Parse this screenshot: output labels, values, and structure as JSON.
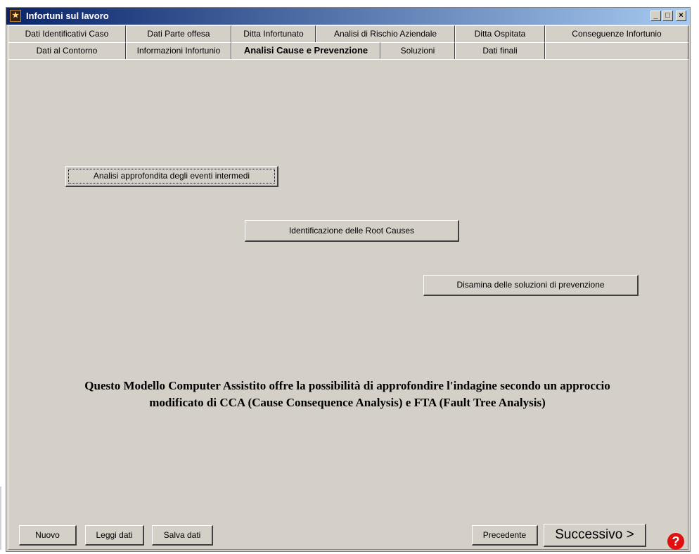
{
  "window": {
    "title": "Infortuni sul lavoro",
    "app_icon": "app-icon",
    "controls": {
      "minimize": "_",
      "maximize": "□",
      "close": "×"
    }
  },
  "tabs": {
    "row1": [
      "Dati Identificativi Caso",
      "Dati Parte offesa",
      "Ditta Infortunato",
      "Analisi di Rischio Aziendale",
      "Ditta Ospitata",
      "Conseguenze Infortunio"
    ],
    "row2": [
      "Dati al Contorno",
      "Informazioni Infortunio",
      "Analisi Cause e Prevenzione",
      "Soluzioni",
      "Dati finali"
    ],
    "active": "Analisi Cause e Prevenzione"
  },
  "main": {
    "buttons": {
      "analisi": "Analisi approfondita degli eventi intermedi",
      "root_causes": "Identificazione delle Root Causes",
      "soluzioni": "Disamina delle soluzioni di prevenzione"
    },
    "info_line1": "Questo Modello Computer Assistito offre la possibilità di approfondire l'indagine secondo un approccio",
    "info_line2": "modificato di CCA (Cause Consequence Analysis) e FTA (Fault Tree Analysis)"
  },
  "footer": {
    "nuovo": "Nuovo",
    "leggi": "Leggi dati",
    "salva": "Salva dati",
    "precedente": "Precedente",
    "successivo": "Successivo >",
    "help": "?"
  },
  "colors": {
    "face": "#d4d0c8",
    "title_start": "#0a246a",
    "title_end": "#a6caf0",
    "help": "#e01010"
  }
}
